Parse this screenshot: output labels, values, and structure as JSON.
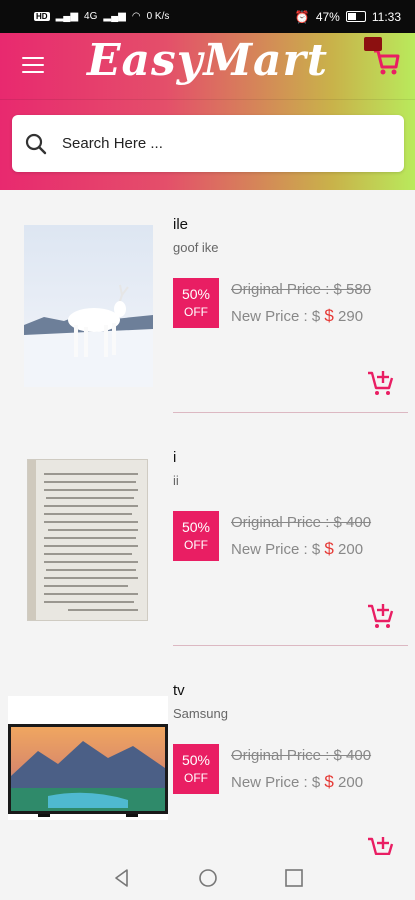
{
  "status_bar": {
    "left_text": "4G",
    "speed": "0 K/s",
    "battery": "47%",
    "time": "11:33"
  },
  "header": {
    "app_title": "EasyMart",
    "menu_icon": "hamburger-menu-icon",
    "cart_icon": "shopping-cart-icon"
  },
  "search": {
    "placeholder": "Search Here ...",
    "icon": "search-icon"
  },
  "products": [
    {
      "name": "ile",
      "description": "goof ike",
      "discount": "50%",
      "discount_label": "OFF",
      "original_price": "Original Price : $ 580",
      "new_price_label": "New Price : $ ",
      "currency": "$",
      "new_price": " 290"
    },
    {
      "name": "i",
      "description": "ii",
      "discount": "50%",
      "discount_label": "OFF",
      "original_price": "Original Price : $ 400",
      "new_price_label": "New Price : $ ",
      "currency": "$",
      "new_price": " 200"
    },
    {
      "name": "tv",
      "description": "Samsung",
      "discount": "50%",
      "discount_label": "OFF",
      "original_price": "Original Price : $ 400",
      "new_price_label": "New Price : $ ",
      "currency": "$",
      "new_price": " 200"
    }
  ],
  "colors": {
    "accent": "#e91e63",
    "price_red": "#e53935",
    "gradient_start": "#e8296f",
    "gradient_end": "#b9ea5c"
  },
  "navigation": [
    "back-icon",
    "home-icon",
    "recents-icon"
  ]
}
